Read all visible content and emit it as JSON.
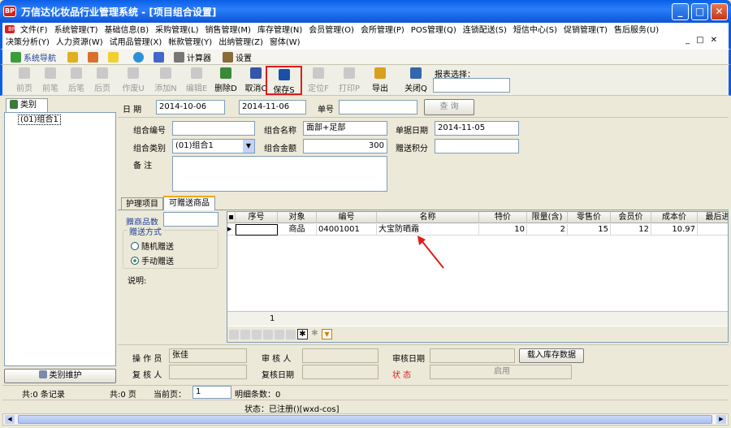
{
  "window": {
    "title": "万信达化妆品行业管理系统 - [项目组合设置]",
    "logo": "BP"
  },
  "menu": {
    "row1": [
      "文件(F)",
      "系统管理(T)",
      "基础信息(B)",
      "采购管理(L)",
      "销售管理(M)",
      "库存管理(N)",
      "会员管理(O)",
      "会所管理(P)",
      "POS管理(Q)",
      "连锁配送(S)",
      "短信中心(S)",
      "促销管理(T)",
      "售后服务(U)"
    ],
    "row2": [
      "决策分析(Y)",
      "人力资源(W)",
      "试用品管理(X)",
      "帐款管理(Y)",
      "出纳管理(Z)",
      "窗体(W)"
    ]
  },
  "nav": {
    "items": [
      "系统导航",
      "计算器",
      "设置"
    ]
  },
  "toolbar": {
    "buttons": [
      "前页",
      "前笔",
      "后笔",
      "后页",
      "作废U",
      "添加N",
      "编辑E",
      "删除D",
      "取消C",
      "保存S",
      "定位F",
      "打印P",
      "导出",
      "关闭Q"
    ],
    "report_label": "报表选择："
  },
  "sidebar": {
    "tab": "类别",
    "tree_item": "(01)组合1",
    "maint_button": "类别维护"
  },
  "search": {
    "date_label": "日  期",
    "date_from": "2014-10-06",
    "date_to": "2014-11-06",
    "doc_label": "单号",
    "doc_value": "",
    "query_button": "查 询"
  },
  "form": {
    "code_label": "组合编号",
    "code": "",
    "name_label": "组合名称",
    "name": "面部+足部",
    "date_label": "单据日期",
    "date": "2014-11-05",
    "type_label": "组合类别",
    "type": "(01)组合1",
    "amount_label": "组合金额",
    "amount": "300",
    "points_label": "赠送积分",
    "points": "",
    "note_label": "备    注",
    "note": ""
  },
  "tabs": {
    "tab1": "护理项目",
    "tab2": "可赠送商品"
  },
  "gift": {
    "count_label": "赠商品数",
    "method_label": "赠送方式",
    "random": "随机赠送",
    "manual": "手动赠送",
    "desc_label": "说明:"
  },
  "grid": {
    "headers": [
      "序号",
      "对象",
      "编号",
      "名称",
      "特价",
      "限量(含)",
      "零售价",
      "会员价",
      "成本价",
      "最后进价"
    ],
    "rows": [
      [
        "",
        "商品",
        "04001001",
        "大宝防晒霜",
        "10",
        "2",
        "15",
        "12",
        "10.97",
        ""
      ]
    ],
    "footer_count": "1"
  },
  "bottom": {
    "operator_label": "操 作 员",
    "operator": "张佳",
    "auditor_label": "审 核 人",
    "auditor": "",
    "audit_date_label": "审核日期",
    "audit_date": "",
    "load_button": "载入库存数据",
    "reviewer_label": "复 核 人",
    "reviewer": "",
    "review_date_label": "复核日期",
    "review_date": "",
    "state_label": "状    态",
    "state_button": "启用"
  },
  "status": {
    "records": "共:0 条记录",
    "pages": "共:0 页",
    "current_label": "当前页：",
    "current": "1",
    "detail": "明细条数：0",
    "bottom": "状态：已注册()[wxd-cos]"
  }
}
